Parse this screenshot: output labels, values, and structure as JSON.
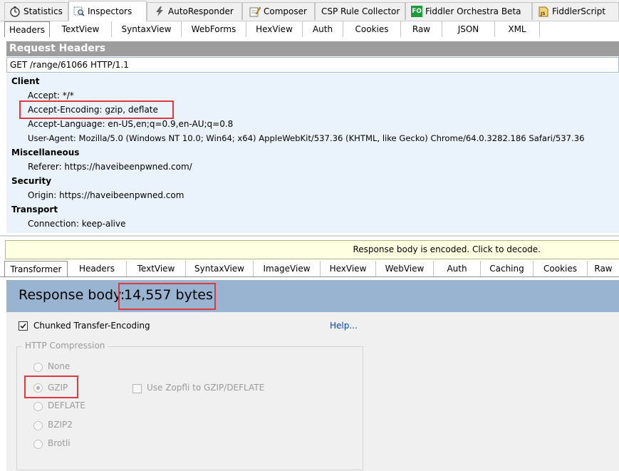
{
  "top_tabs": [
    {
      "label": "Statistics",
      "icon": "stopwatch-icon"
    },
    {
      "label": "Inspectors",
      "icon": "inspectors-icon"
    },
    {
      "label": "AutoResponder",
      "icon": "lightning-icon"
    },
    {
      "label": "Composer",
      "icon": "composer-icon"
    },
    {
      "label": "CSP Rule Collector",
      "icon": ""
    },
    {
      "label": "Fiddler Orchestra Beta",
      "icon": "fo-icon",
      "icon_text": "FO"
    },
    {
      "label": "FiddlerScript",
      "icon": "js-script-icon",
      "icon_text": "JS"
    }
  ],
  "request_tabs": [
    "Headers",
    "TextView",
    "SyntaxView",
    "WebForms",
    "HexView",
    "Auth",
    "Cookies",
    "Raw",
    "JSON",
    "XML"
  ],
  "request_headers": {
    "title": "Request Headers",
    "request_line": "GET /range/61066 HTTP/1.1",
    "groups": [
      {
        "name": "Client",
        "headers": [
          "Accept: */*",
          "Accept-Encoding: gzip, deflate",
          "Accept-Language: en-US,en;q=0.9,en-AU;q=0.8",
          "User-Agent: Mozilla/5.0 (Windows NT 10.0; Win64; x64) AppleWebKit/537.36 (KHTML, like Gecko) Chrome/64.0.3282.186 Safari/537.36"
        ]
      },
      {
        "name": "Miscellaneous",
        "headers": [
          "Referer: https://haveibeenpwned.com/"
        ]
      },
      {
        "name": "Security",
        "headers": [
          "Origin: https://haveibeenpwned.com"
        ]
      },
      {
        "name": "Transport",
        "headers": [
          "Connection: keep-alive"
        ]
      }
    ]
  },
  "encoded_notice": "Response body is encoded. Click to decode.",
  "response_tabs": [
    "Transformer",
    "Headers",
    "TextView",
    "SyntaxView",
    "ImageView",
    "HexView",
    "WebView",
    "Auth",
    "Caching",
    "Cookies",
    "Raw"
  ],
  "transformer": {
    "response_body_label": "Response body:",
    "response_body_size": "14,557 bytes.",
    "chunked_label": "Chunked Transfer-Encoding",
    "chunked_checked": true,
    "help_link": "Help...",
    "compression_title": "HTTP Compression",
    "compression_options": [
      "None",
      "GZIP",
      "DEFLATE",
      "BZIP2",
      "Brotli"
    ],
    "selected_compression": "GZIP",
    "zopfli_label": "Use Zopfli to GZIP/DEFLATE",
    "zopfli_checked": false
  },
  "colors": {
    "highlight_box": "#e0383e",
    "request_tree_bg": "#eaf3fc",
    "response_body_bg": "#99b4d1",
    "notice_bg": "#ffffe1",
    "link": "#0645ad"
  }
}
